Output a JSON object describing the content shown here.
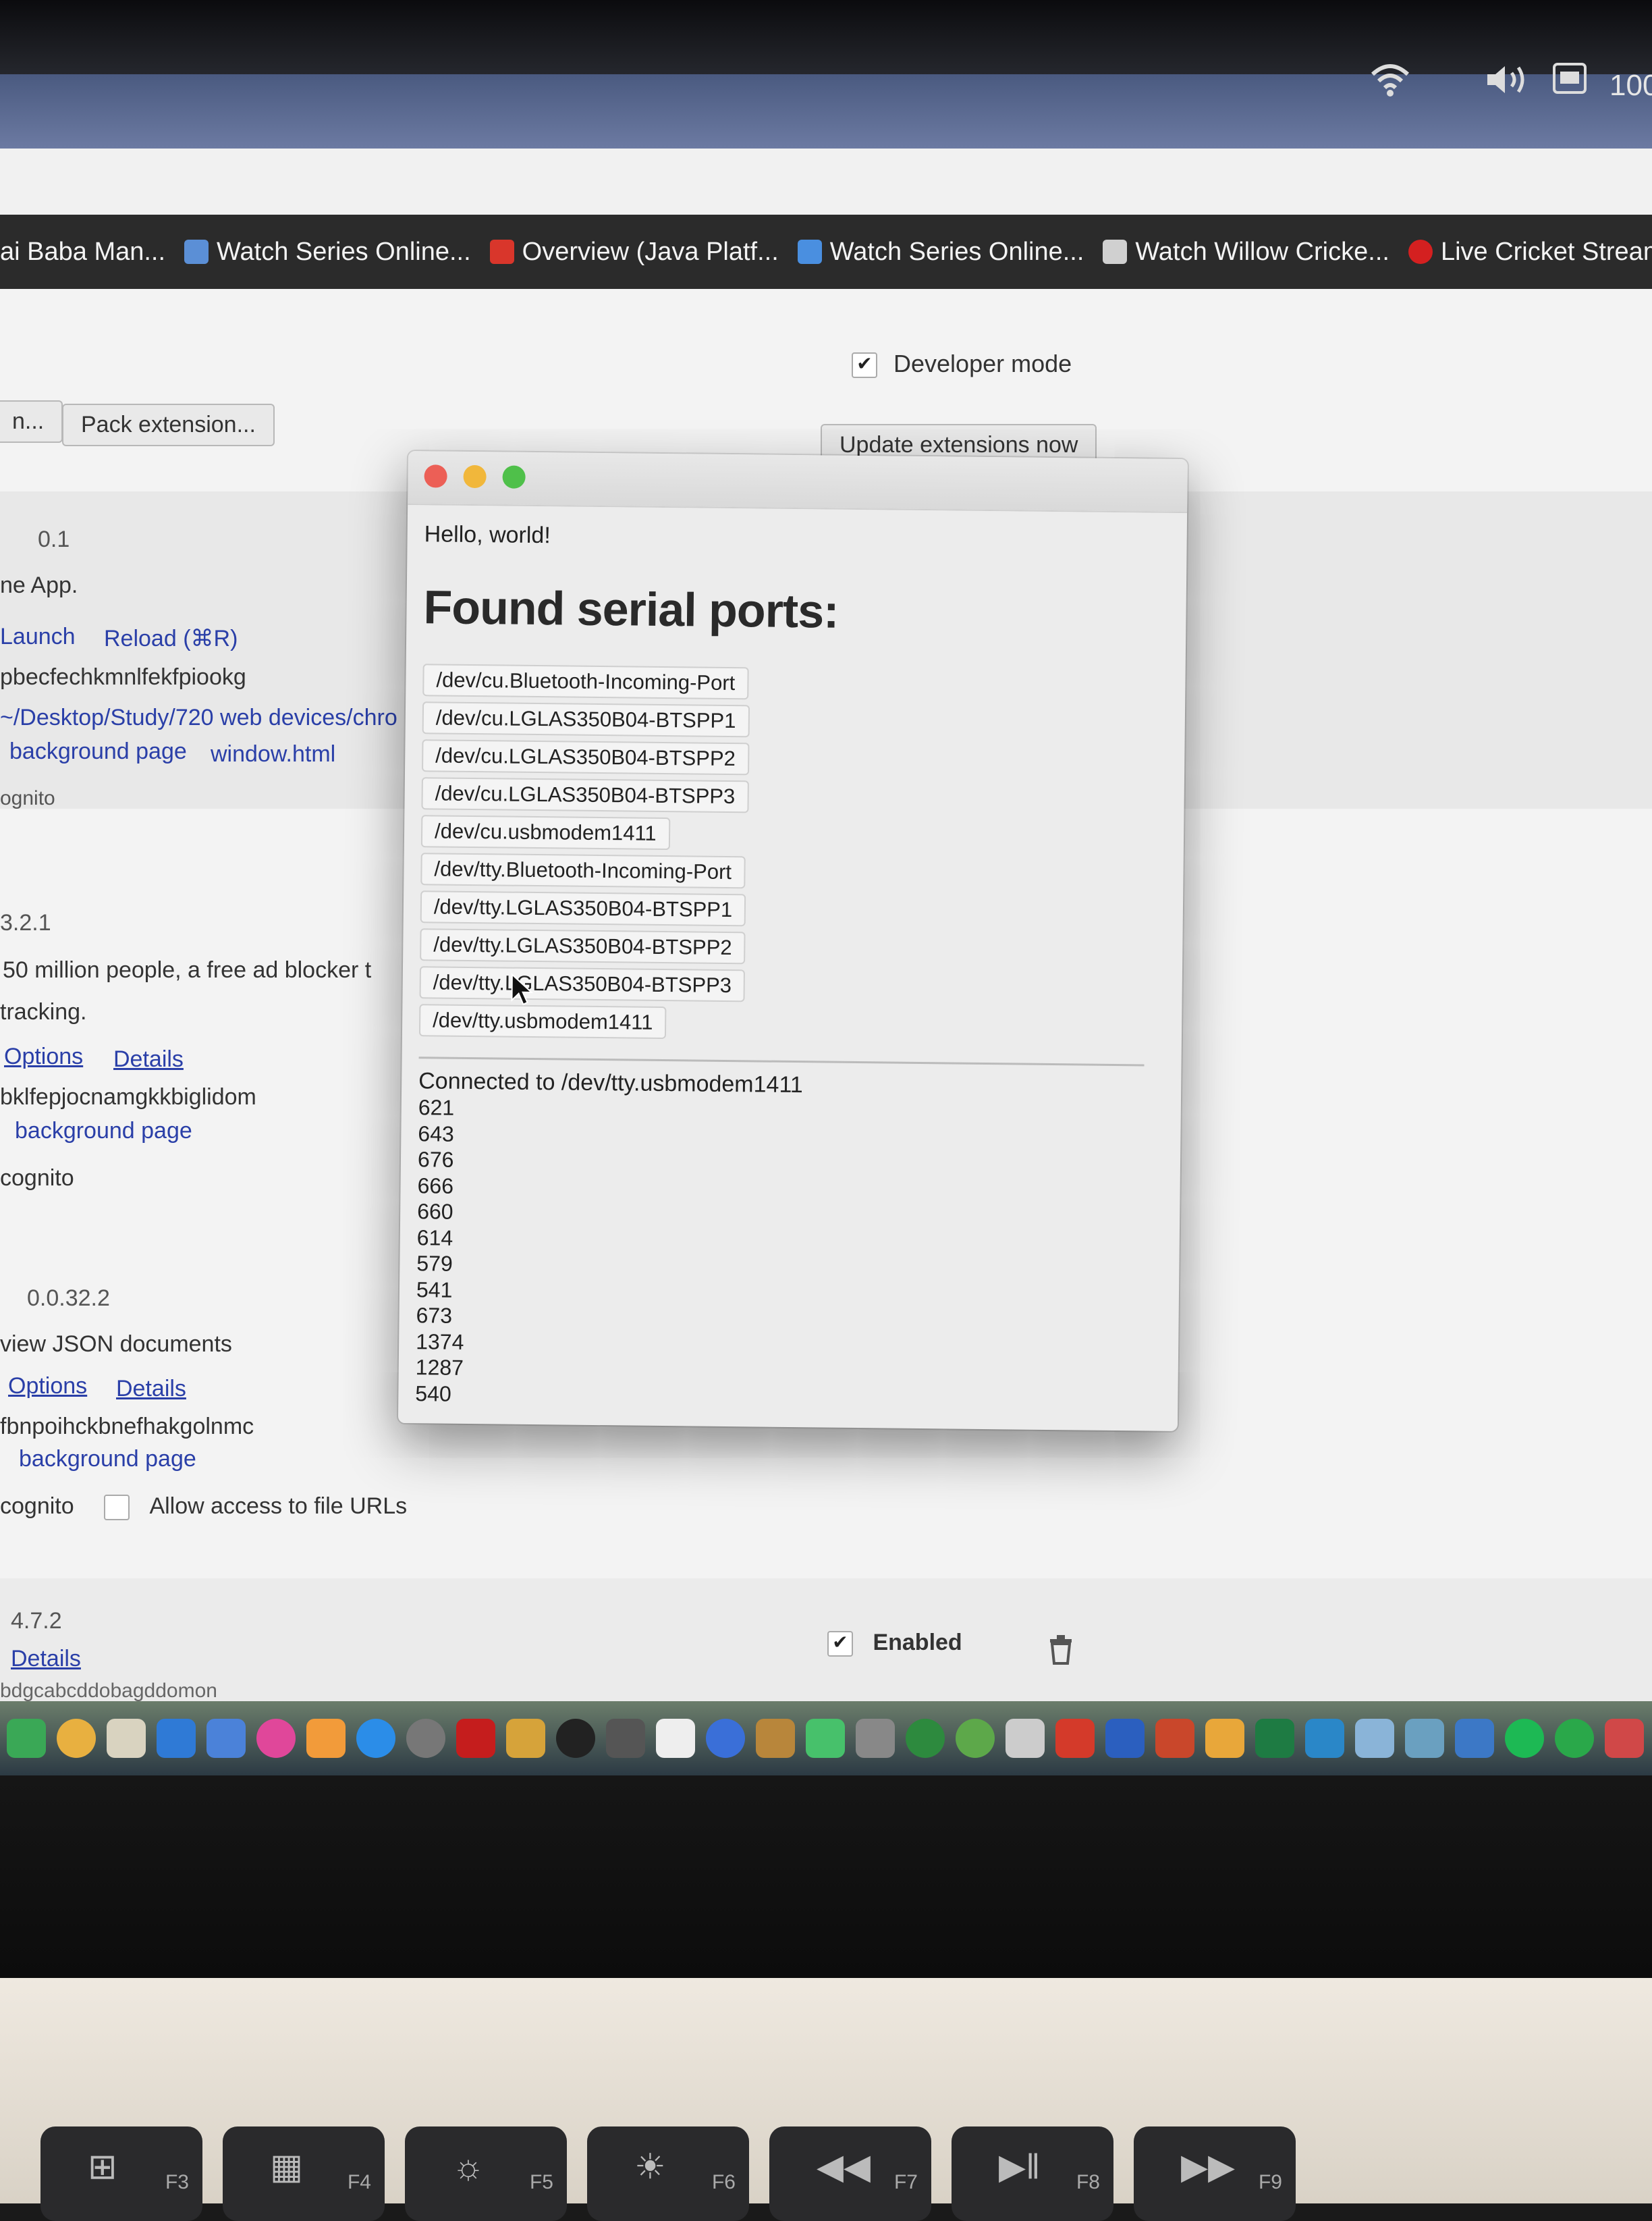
{
  "menubar": {
    "battery": "100"
  },
  "bookmarks": [
    {
      "label": "ai Baba Man...",
      "color": "#8a8a8a"
    },
    {
      "label": "Watch Series Online...",
      "color": "#5b8fd6"
    },
    {
      "label": "Overview (Java Platf...",
      "color": "#d9362b"
    },
    {
      "label": "Watch Series Online...",
      "color": "#4a8fe0"
    },
    {
      "label": "Watch Willow Cricke...",
      "color": "#d0d0d0"
    },
    {
      "label": "Live Cricket Stream",
      "color": "#d42020"
    }
  ],
  "extensions_page": {
    "developer_mode_label": "Developer mode",
    "load_unpacked_label": "n...",
    "pack_extension_label": "Pack extension...",
    "update_now_label": "Update extensions now",
    "ext1": {
      "version": "0.1",
      "desc": "ne App.",
      "launch": "Launch",
      "reload": "Reload (⌘R)",
      "id": "pbecfechkmnlfekfpiookg",
      "path": "~/Desktop/Study/720 web devices/chro",
      "background_page": "background page",
      "window_html": "window.html",
      "incognito": "ognito"
    },
    "ext2": {
      "version": "3.2.1",
      "desc1": "50 million people, a free ad blocker t",
      "desc2": "tracking.",
      "options": "Options",
      "details": "Details",
      "id": "bklfepjocnamgkkbiglidom",
      "background_page": "background page",
      "incognito": "cognito"
    },
    "ext3": {
      "version": "0.0.32.2",
      "desc": "view JSON documents",
      "options": "Options",
      "details": "Details",
      "id": "fbnpoihckbnefhakgolnmc",
      "background_page": "background page",
      "incognito": "cognito",
      "file_urls_label": "Allow access to file URLs"
    },
    "ext4": {
      "version": "4.7.2",
      "details": "Details",
      "id": "bdgcabcddobagddomon",
      "enabled_label": "Enabled"
    }
  },
  "popup": {
    "hello": "Hello, world!",
    "heading": "Found serial ports:",
    "ports": [
      "/dev/cu.Bluetooth-Incoming-Port",
      "/dev/cu.LGLAS350B04-BTSPP1",
      "/dev/cu.LGLAS350B04-BTSPP2",
      "/dev/cu.LGLAS350B04-BTSPP3",
      "/dev/cu.usbmodem1411",
      "/dev/tty.Bluetooth-Incoming-Port",
      "/dev/tty.LGLAS350B04-BTSPP1",
      "/dev/tty.LGLAS350B04-BTSPP2",
      "/dev/tty.LGLAS350B04-BTSPP3",
      "/dev/tty.usbmodem1411"
    ],
    "connected": "Connected to /dev/tty.usbmodem1411",
    "readings": [
      "621",
      "643",
      "676",
      "666",
      "660",
      "614",
      "579",
      "541",
      "673",
      "1374",
      "1287",
      "540"
    ]
  },
  "keys": [
    {
      "label": "F3",
      "icon": "⊞"
    },
    {
      "label": "F4",
      "icon": "▦"
    },
    {
      "label": "F5",
      "icon": "☼"
    },
    {
      "label": "F6",
      "icon": "☀"
    },
    {
      "label": "F7",
      "icon": "◀◀"
    },
    {
      "label": "F8",
      "icon": "▶‖"
    },
    {
      "label": "F9",
      "icon": "▶▶"
    }
  ],
  "colors": {
    "close": "#ec5f56",
    "minimize": "#f1b73b",
    "zoom": "#4fc04a",
    "link": "#2a3fa8"
  }
}
